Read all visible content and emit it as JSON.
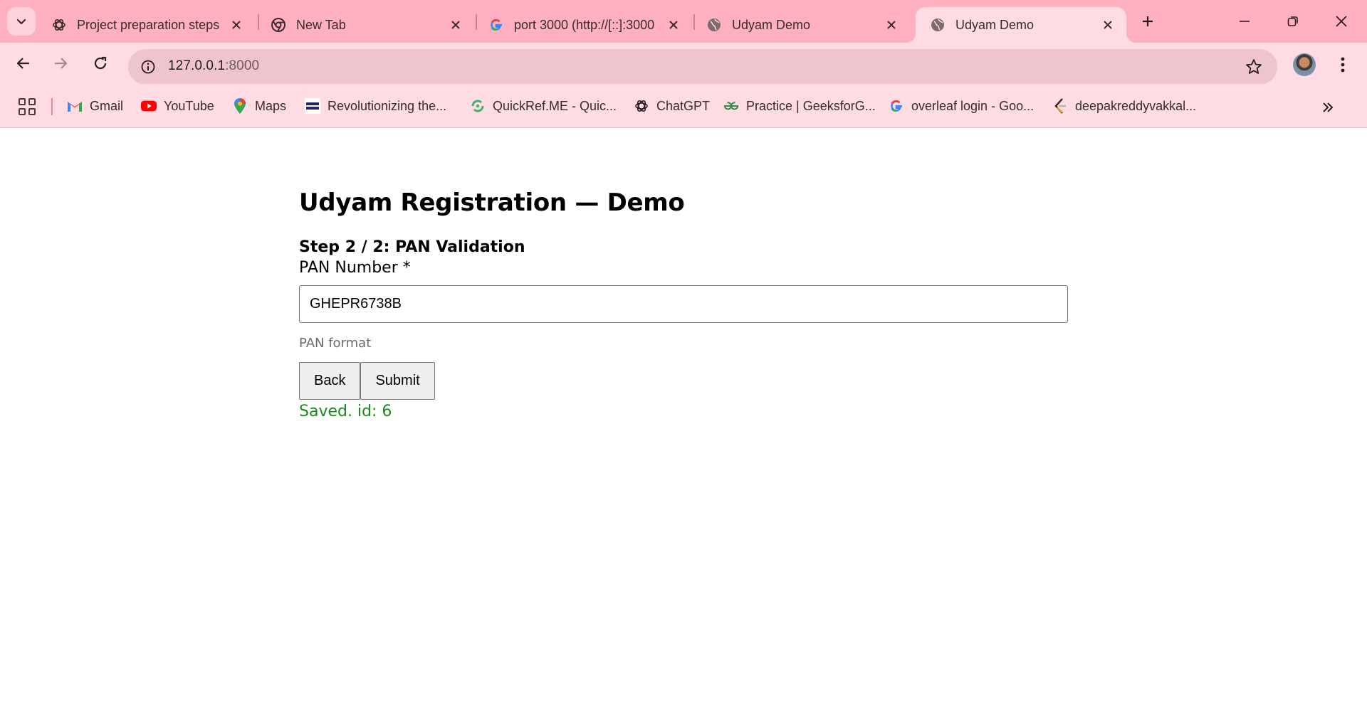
{
  "browser": {
    "tabs": [
      {
        "title": "Project preparation steps",
        "icon": "chatgpt-icon"
      },
      {
        "title": "New Tab",
        "icon": "chrome-icon"
      },
      {
        "title": "port 3000 (http://[::]:3000",
        "icon": "google-icon"
      },
      {
        "title": "Udyam Demo",
        "icon": "globe-icon"
      },
      {
        "title": "Udyam Demo",
        "icon": "globe-icon",
        "active": true
      }
    ],
    "url_host": "127.0.0.1",
    "url_port": ":8000",
    "bookmarks": [
      {
        "label": "Gmail",
        "icon": "gmail-icon"
      },
      {
        "label": "YouTube",
        "icon": "youtube-icon"
      },
      {
        "label": "Maps",
        "icon": "maps-icon"
      },
      {
        "label": "Revolutionizing the...",
        "icon": "nxtwave-icon"
      },
      {
        "label": "QuickRef.ME - Quic...",
        "icon": "quickref-icon"
      },
      {
        "label": "ChatGPT",
        "icon": "chatgpt-icon"
      },
      {
        "label": "Practice | GeeksforG...",
        "icon": "geeksforgeeks-icon"
      },
      {
        "label": "overleaf login - Goo...",
        "icon": "google-icon"
      },
      {
        "label": "deepakreddyvakkal...",
        "icon": "leetcode-icon"
      }
    ]
  },
  "page": {
    "title": "Udyam Registration — Demo",
    "step": "Step 2 / 2: PAN Validation",
    "pan_label": "PAN Number *",
    "pan_value": "GHEPR6738B",
    "hint": "PAN format",
    "back_label": "Back",
    "submit_label": "Submit",
    "status": "Saved. id: 6"
  },
  "colors": {
    "tabstrip": "#ffb0c0",
    "toolbar": "#ffdce4",
    "status_green": "#1a8a1a"
  }
}
